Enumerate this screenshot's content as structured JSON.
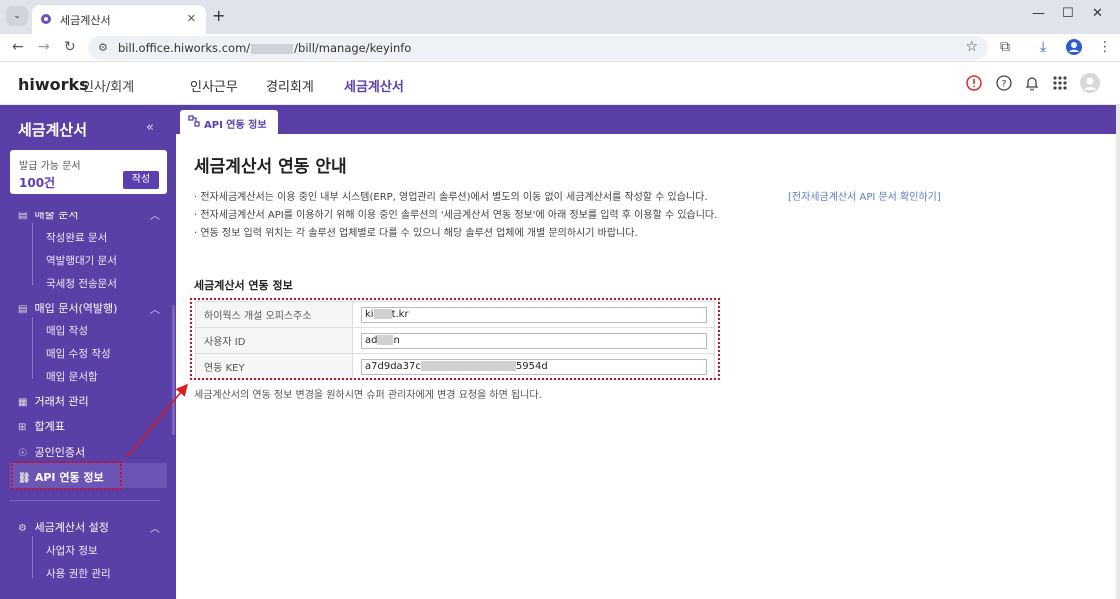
{
  "browser": {
    "tab_title": "세금계산서",
    "url_prefix": "bill.office.hiworks.com/",
    "url_suffix": "/bill/manage/keyinfo"
  },
  "app": {
    "logo": "hiworks",
    "logo_sub": "인사/회계",
    "nav": [
      "인사근무",
      "경리회계",
      "세금계산서"
    ],
    "active_nav": "세금계산서"
  },
  "sidebar": {
    "title": "세금계산서",
    "issue_label": "발급 가능 문서",
    "issue_count": "100건",
    "write_label": "작성",
    "section_sales": "매출 문서",
    "sales_items": [
      "작성완료 문서",
      "역발행대기 문서",
      "국세청 전송문서"
    ],
    "section_purchase": "매입 문서(역발행)",
    "purchase_items": [
      "매입 작성",
      "매입 수정 작성",
      "매입 문서함"
    ],
    "partners": "거래처 관리",
    "summary": "합계표",
    "cert": "공인인증서",
    "api": "API 연동 정보",
    "section_settings": "세금계산서 설정",
    "settings_items": [
      "사업자 정보",
      "사용 권한 관리"
    ]
  },
  "content": {
    "tab_label": "API 연동 정보",
    "title": "세금계산서 연동 안내",
    "desc": [
      "· 전자세금계산서는 이용 중인 내부 시스템(ERP, 영업관리 솔루션)에서 별도의 이동 없이 세금계산서를 작성할 수 있습니다.",
      "· 전자세금계산서 API를 이용하기 위해 이용 중인 솔루션의 '세금계산서 연동 정보'에 아래 정보를 입력 후 이용할 수 있습니다.",
      "· 연동 정보 입력 위치는 각 솔루션 업체별로 다를 수 있으니 해당 솔루션 업체에 개별 문의하시기 바랍니다."
    ],
    "doc_link": "[전자세금계산서 API 문서 확인하기]",
    "section_title": "세금계산서 연동 정보",
    "rows": [
      {
        "label": "하이웍스 개설 오피스주소",
        "value_start": "ki",
        "value_end": "t.kr"
      },
      {
        "label": "사용자 ID",
        "value_start": "ad",
        "value_end": "n"
      },
      {
        "label": "연동 KEY",
        "value_start": "a7d9da37c",
        "value_end": "5954d"
      }
    ],
    "note": "세금계산서의 연동 정보 변경을 원하시면 슈퍼 관리자에게 변경 요청을 하면 됩니다."
  },
  "colors": {
    "brand": "#5a3fa6",
    "highlight": "#c8102e",
    "link": "#5a7fc7"
  }
}
